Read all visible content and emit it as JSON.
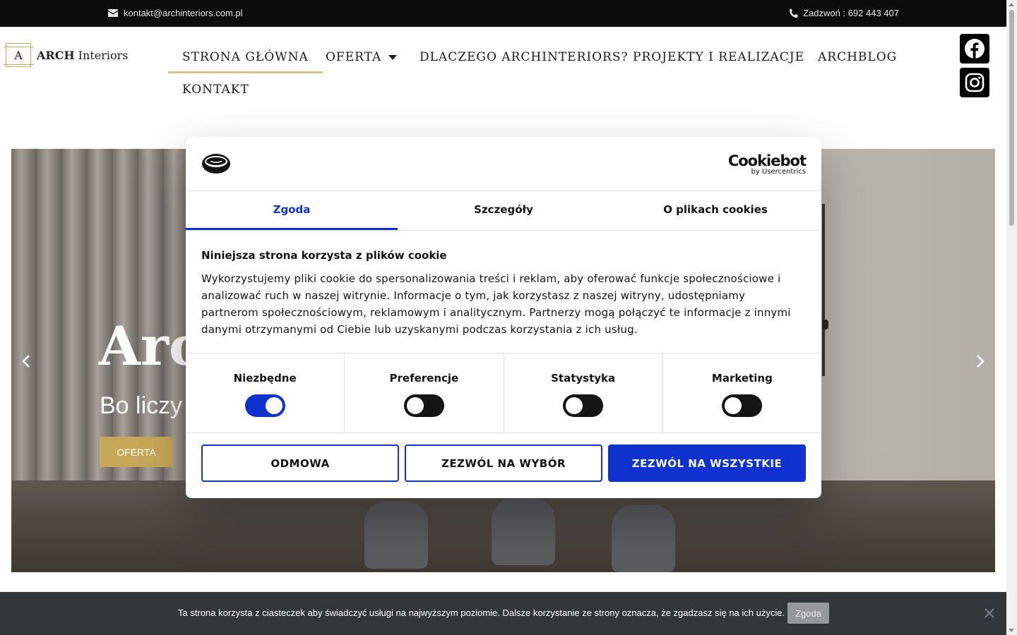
{
  "topbar": {
    "email": "kontakt@archinteriors.com.pl",
    "phone": "Zadzwoń : 692 443 407",
    "email_icon": "envelope-icon",
    "phone_icon": "phone-icon"
  },
  "header": {
    "logo_mark": "A",
    "logo_brand_bold": "ARCH",
    "logo_brand_rest": " Interiors",
    "nav": [
      {
        "label": "STRONA GŁÓWNA",
        "active": true
      },
      {
        "label": "OFERTA",
        "has_caret": true
      },
      {
        "label": "DLACZEGO ARCHINTERIORS?"
      },
      {
        "label": "PROJEKTY I REALIZACJE"
      },
      {
        "label": "ARCHBLOG"
      },
      {
        "label": "KONTAKT"
      }
    ],
    "social": [
      "facebook-icon",
      "instagram-icon"
    ]
  },
  "hero": {
    "title": "Arc",
    "subtitle": "Bo liczy",
    "button": "OFERTA"
  },
  "cookiebot": {
    "brand": "Cookiebot",
    "brand_sub": "by Usercentrics",
    "tabs": [
      {
        "label": "Zgoda",
        "active": true
      },
      {
        "label": "Szczegóły"
      },
      {
        "label": "O plikach cookies"
      }
    ],
    "heading": "Niniejsza strona korzysta z plików cookie",
    "body": "Wykorzystujemy pliki cookie do spersonalizowania treści i reklam, aby oferować funkcje społecznościowe i analizować ruch w naszej witrynie. Informacje o tym, jak korzystasz z naszej witryny, udostępniamy partnerom społecznościowym, reklamowym i analitycznym. Partnerzy mogą połączyć te informacje z innymi danymi otrzymanymi od Ciebie lub uzyskanymi podczas korzystania z ich usług.",
    "categories": [
      {
        "label": "Niezbędne",
        "on": true
      },
      {
        "label": "Preferencje",
        "on": false
      },
      {
        "label": "Statystyka",
        "on": false
      },
      {
        "label": "Marketing",
        "on": false
      }
    ],
    "buttons": {
      "deny": "ODMOWA",
      "allow_selection": "ZEZWÓL NA WYBÓR",
      "allow_all": "ZEZWÓL NA WSZYSTKIE"
    },
    "accent": "#1032cf"
  },
  "notice": {
    "text": "Ta strona korzysta z ciasteczek aby świadczyć usługi na najwyższym poziomie. Dalsze korzystanie ze strony oznacza, że zgadzasz się na ich użycie.",
    "button": "Zgoda"
  },
  "colors": {
    "gold": "#c7a859",
    "nav_underline": "#d6c68d",
    "notice_bg": "#32373c"
  }
}
